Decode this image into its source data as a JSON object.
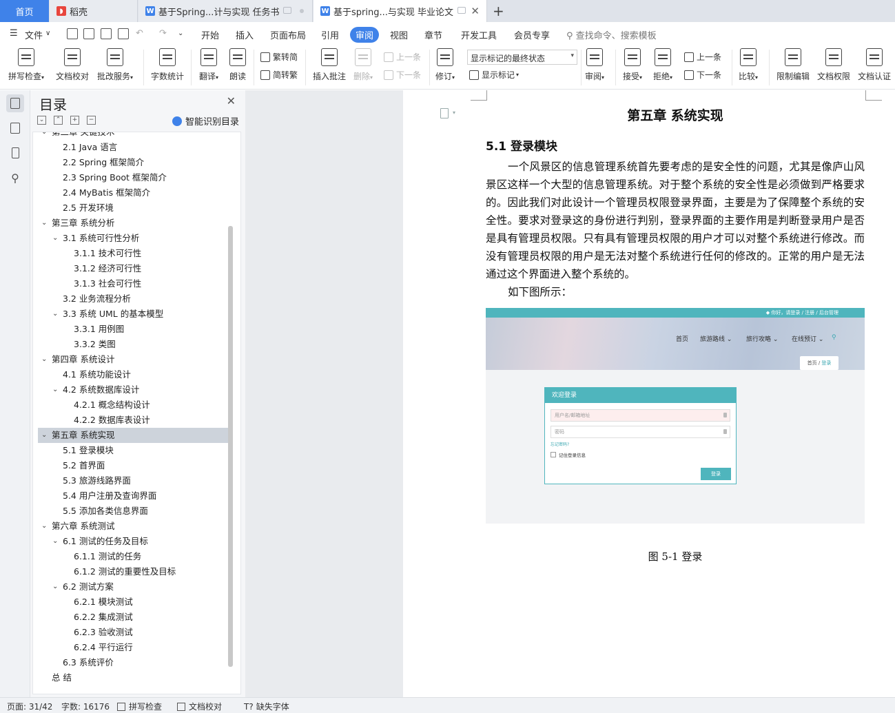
{
  "tabs": [
    {
      "label": "首页"
    },
    {
      "label": "稻壳"
    },
    {
      "label": "基于Spring...计与实现 任务书"
    },
    {
      "label": "基于spring...与实现 毕业论文"
    }
  ],
  "menu": {
    "file": "文件",
    "items": [
      "开始",
      "插入",
      "页面布局",
      "引用",
      "审阅",
      "视图",
      "章节",
      "开发工具",
      "会员专享"
    ],
    "search_placeholder": "查找命令、搜索模板"
  },
  "ribbon": {
    "spell_check": "拼写检查",
    "doc_proof": "文档校对",
    "annotate_service": "批改服务",
    "word_count": "字数统计",
    "translate": "翻译",
    "read_aloud": "朗读",
    "trad_to_simp": "繁转简",
    "simp_to_trad": "简转繁",
    "insert_comment": "插入批注",
    "delete": "删除",
    "prev_comment": "上一条",
    "next_comment": "下一条",
    "revise": "修订",
    "markup_state": "显示标记的最终状态",
    "show_markup": "显示标记",
    "review": "审阅",
    "accept": "接受",
    "reject": "拒绝",
    "prev_change": "上一条",
    "next_change": "下一条",
    "compare": "比较",
    "restrict_edit": "限制编辑",
    "doc_permission": "文档权限",
    "doc_certify": "文档认证"
  },
  "toc": {
    "title": "目录",
    "smart_label": "智能识别目录",
    "items": [
      {
        "text": "第二章  关键技术",
        "level": 1,
        "arrow": true
      },
      {
        "text": "2.1 Java 语言",
        "level": 2,
        "arrow": false
      },
      {
        "text": "2.2 Spring 框架简介",
        "level": 2,
        "arrow": false
      },
      {
        "text": "2.3 Spring Boot 框架简介",
        "level": 2,
        "arrow": false
      },
      {
        "text": "2.4 MyBatis  框架简介",
        "level": 2,
        "arrow": false
      },
      {
        "text": "2.5  开发环境",
        "level": 2,
        "arrow": false
      },
      {
        "text": "第三章  系统分析",
        "level": 1,
        "arrow": true
      },
      {
        "text": "3.1  系统可行性分析",
        "level": 2,
        "arrow": true
      },
      {
        "text": "3.1.1  技术可行性",
        "level": 3,
        "arrow": false
      },
      {
        "text": "3.1.2  经济可行性",
        "level": 3,
        "arrow": false
      },
      {
        "text": "3.1.3  社会可行性",
        "level": 3,
        "arrow": false
      },
      {
        "text": "3.2  业务流程分析",
        "level": 2,
        "arrow": false
      },
      {
        "text": "3.3  系统 UML 的基本模型",
        "level": 2,
        "arrow": true
      },
      {
        "text": "3.3.1  用例图",
        "level": 3,
        "arrow": false
      },
      {
        "text": "3.3.2  类图",
        "level": 3,
        "arrow": false
      },
      {
        "text": "第四章  系统设计",
        "level": 1,
        "arrow": true
      },
      {
        "text": "4.1  系统功能设计",
        "level": 2,
        "arrow": false
      },
      {
        "text": "4.2  系统数据库设计",
        "level": 2,
        "arrow": true
      },
      {
        "text": "4.2.1  概念结构设计",
        "level": 3,
        "arrow": false
      },
      {
        "text": "4.2.2  数据库表设计",
        "level": 3,
        "arrow": false
      },
      {
        "text": "第五章  系统实现",
        "level": 1,
        "arrow": true,
        "selected": true
      },
      {
        "text": "5.1 登录模块",
        "level": 2,
        "arrow": false
      },
      {
        "text": "5.2  首界面",
        "level": 2,
        "arrow": false
      },
      {
        "text": "5.3  旅游线路界面",
        "level": 2,
        "arrow": false
      },
      {
        "text": "5.4  用户注册及查询界面",
        "level": 2,
        "arrow": false
      },
      {
        "text": "5.5  添加各类信息界面",
        "level": 2,
        "arrow": false
      },
      {
        "text": "第六章  系统测试",
        "level": 1,
        "arrow": true
      },
      {
        "text": "6.1 测试的任务及目标",
        "level": 2,
        "arrow": true
      },
      {
        "text": "6.1.1 测试的任务",
        "level": 3,
        "arrow": false
      },
      {
        "text": "6.1.2 测试的重要性及目标",
        "level": 3,
        "arrow": false
      },
      {
        "text": "6.2 测试方案",
        "level": 2,
        "arrow": true
      },
      {
        "text": "6.2.1 模块测试",
        "level": 3,
        "arrow": false
      },
      {
        "text": "6.2.2 集成测试",
        "level": 3,
        "arrow": false
      },
      {
        "text": "6.2.3 验收测试",
        "level": 3,
        "arrow": false
      },
      {
        "text": "6.2.4 平行运行",
        "level": 3,
        "arrow": false
      },
      {
        "text": "6.3 系统评价",
        "level": 2,
        "arrow": false
      },
      {
        "text": "总    结",
        "level": 1,
        "arrow": false
      }
    ]
  },
  "document": {
    "chapter_title": "第五章  系统实现",
    "section_title": "5.1 登录模块",
    "paragraph": "一个风景区的信息管理系统首先要考虑的是安全性的问题，尤其是像庐山风景区这样一个大型的信息管理系统。对于整个系统的安全性是必须做到严格要求的。因此我们对此设计一个管理员权限登录界面，主要是为了保障整个系统的安全性。要求对登录这的身份进行判别，登录界面的主要作用是判断登录用户是否是具有管理员权限。只有具有管理员权限的用户才可以对整个系统进行修改。而没有管理员权限的用户是无法对整个系统进行任何的修改的。正常的用户是无法通过这个界面进入整个系统的。",
    "paragraph2": "如下图所示：",
    "caption": "图 5-1 登录"
  },
  "figure": {
    "top_links": "◆ 你好，请登录 / 注册 / 后台管理",
    "nav": [
      "首页",
      "旅游路线 ⌄",
      "旅行攻略 ⌄",
      "在线预订 ⌄"
    ],
    "crumb_home": "首页",
    "crumb_sep": " / ",
    "crumb_current": "登录",
    "login_title": "欢迎登录",
    "username_placeholder": "用户名/邮箱地址",
    "password_placeholder": "密码",
    "forgot": "忘记密码?",
    "remember": "记住登录信息",
    "login_button": "登录"
  },
  "status": {
    "page": "页面: 31/42",
    "words": "字数: 16176",
    "spell": "拼写检查",
    "proof": "文档校对",
    "missing_font": "缺失字体"
  }
}
